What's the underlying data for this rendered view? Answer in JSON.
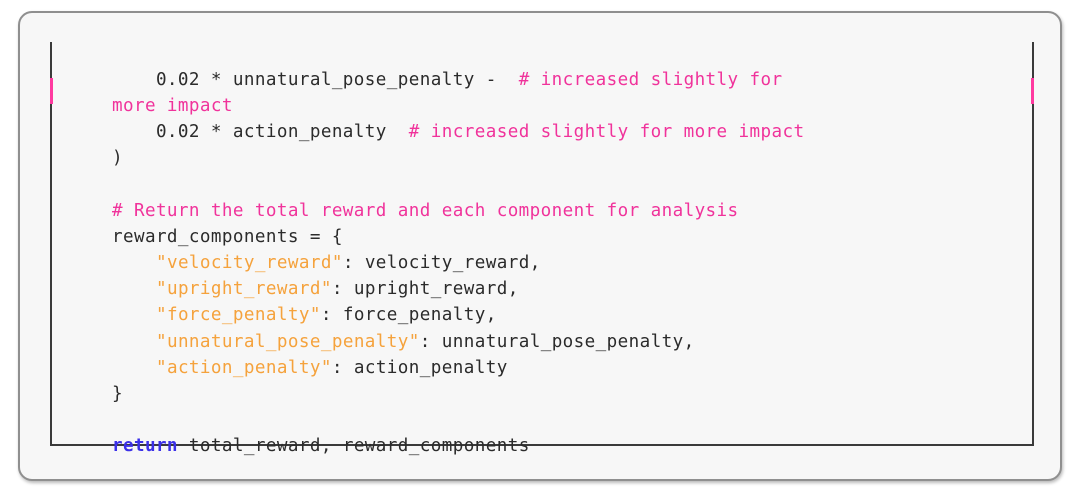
{
  "editor": {
    "language": "python",
    "background_color": "#f7f7f7",
    "frame_border_color": "#3a3a3a",
    "card_border_color": "#8f8f8f",
    "wrap_marker_color": "#ff3aa0",
    "colors": {
      "plain": "#2b2b2b",
      "comment": "#f0339b",
      "string": "#f5a23c",
      "keyword": "#3b30e8"
    },
    "lines": [
      {
        "id": "line-1",
        "tokens": [
          {
            "type": "plain",
            "text": "        0.02 * unnatural_pose_penalty -  "
          },
          {
            "type": "comment",
            "text": "# increased slightly for"
          }
        ]
      },
      {
        "id": "line-2-wrapped",
        "tokens": [
          {
            "type": "comment",
            "text": "    more impact"
          }
        ]
      },
      {
        "id": "line-3",
        "tokens": [
          {
            "type": "plain",
            "text": "        0.02 * action_penalty  "
          },
          {
            "type": "comment",
            "text": "# increased slightly for more impact"
          }
        ]
      },
      {
        "id": "line-4",
        "tokens": [
          {
            "type": "plain",
            "text": "    )"
          }
        ]
      },
      {
        "id": "line-5-blank",
        "tokens": [
          {
            "type": "plain",
            "text": ""
          }
        ]
      },
      {
        "id": "line-6",
        "tokens": [
          {
            "type": "comment",
            "text": "    # Return the total reward and each component for analysis"
          }
        ]
      },
      {
        "id": "line-7",
        "tokens": [
          {
            "type": "plain",
            "text": "    reward_components = {"
          }
        ]
      },
      {
        "id": "line-8",
        "tokens": [
          {
            "type": "plain",
            "text": "        "
          },
          {
            "type": "string",
            "text": "\"velocity_reward\""
          },
          {
            "type": "plain",
            "text": ": velocity_reward,"
          }
        ]
      },
      {
        "id": "line-9",
        "tokens": [
          {
            "type": "plain",
            "text": "        "
          },
          {
            "type": "string",
            "text": "\"upright_reward\""
          },
          {
            "type": "plain",
            "text": ": upright_reward,"
          }
        ]
      },
      {
        "id": "line-10",
        "tokens": [
          {
            "type": "plain",
            "text": "        "
          },
          {
            "type": "string",
            "text": "\"force_penalty\""
          },
          {
            "type": "plain",
            "text": ": force_penalty,"
          }
        ]
      },
      {
        "id": "line-11",
        "tokens": [
          {
            "type": "plain",
            "text": "        "
          },
          {
            "type": "string",
            "text": "\"unnatural_pose_penalty\""
          },
          {
            "type": "plain",
            "text": ": unnatural_pose_penalty,"
          }
        ]
      },
      {
        "id": "line-12",
        "tokens": [
          {
            "type": "plain",
            "text": "        "
          },
          {
            "type": "string",
            "text": "\"action_penalty\""
          },
          {
            "type": "plain",
            "text": ": action_penalty"
          }
        ]
      },
      {
        "id": "line-13",
        "tokens": [
          {
            "type": "plain",
            "text": "    }"
          }
        ]
      },
      {
        "id": "line-14-blank",
        "tokens": [
          {
            "type": "plain",
            "text": ""
          }
        ]
      },
      {
        "id": "line-15",
        "tokens": [
          {
            "type": "keyword",
            "text": "    return"
          },
          {
            "type": "plain",
            "text": " total_reward, reward_components"
          }
        ]
      }
    ]
  }
}
